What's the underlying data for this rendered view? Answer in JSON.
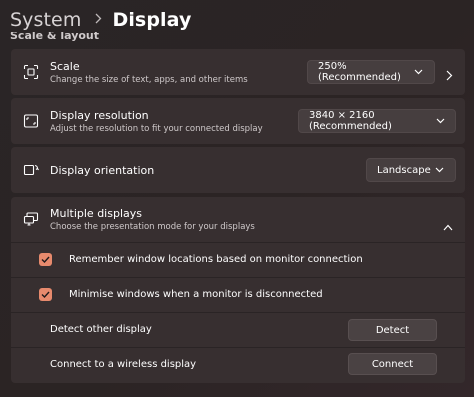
{
  "breadcrumb": {
    "parent": "System",
    "current": "Display"
  },
  "section_label": "Scale & layout",
  "scale": {
    "title": "Scale",
    "subtitle": "Change the size of text, apps, and other items",
    "value": "250% (Recommended)",
    "icon": "scale-icon"
  },
  "resolution": {
    "title": "Display resolution",
    "subtitle": "Adjust the resolution to fit your connected display",
    "value": "3840 × 2160 (Recommended)",
    "icon": "resolution-icon"
  },
  "orientation": {
    "title": "Display orientation",
    "value": "Landscape",
    "icon": "orientation-icon"
  },
  "multiple_displays": {
    "title": "Multiple displays",
    "subtitle": "Choose the presentation mode for your displays",
    "expanded": true,
    "icon": "multiple-displays-icon",
    "options": [
      {
        "label": "Remember window locations based on monitor connection",
        "checked": true
      },
      {
        "label": "Minimise windows when a monitor is disconnected",
        "checked": true
      }
    ],
    "detect": {
      "label": "Detect other display",
      "button": "Detect"
    },
    "wireless": {
      "label": "Connect to a wireless display",
      "button": "Connect"
    }
  },
  "colors": {
    "accent": "#e78a6d",
    "card": "#372f30"
  }
}
